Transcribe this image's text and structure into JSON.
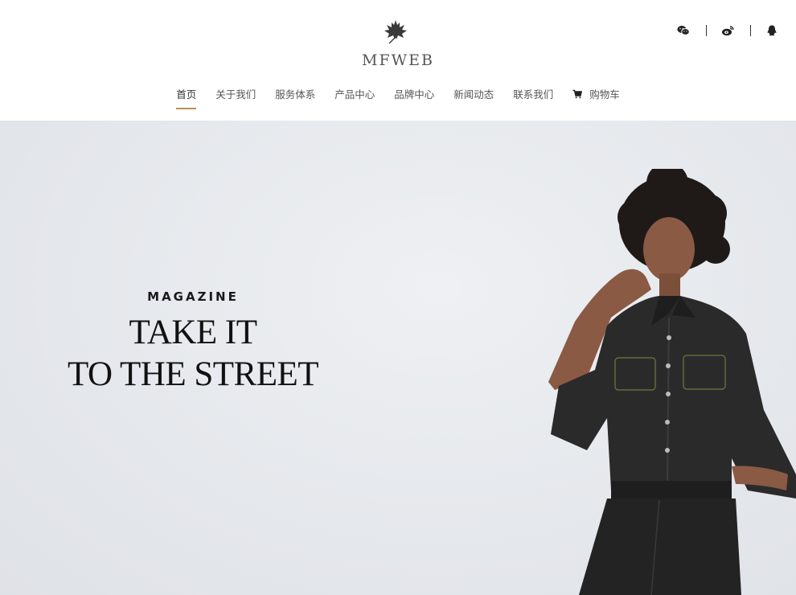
{
  "header": {
    "logo_text": "MFWEB",
    "social": [
      {
        "icon": "wechat-icon"
      },
      {
        "icon": "weibo-icon"
      },
      {
        "icon": "qq-icon"
      }
    ]
  },
  "nav": {
    "items": [
      {
        "label": "首页",
        "active": true
      },
      {
        "label": "关于我们"
      },
      {
        "label": "服务体系"
      },
      {
        "label": "产品中心"
      },
      {
        "label": "品牌中心"
      },
      {
        "label": "新闻动态"
      },
      {
        "label": "联系我们"
      },
      {
        "label": "购物车",
        "icon": "cart-icon"
      }
    ]
  },
  "hero": {
    "kicker": "MAGAZINE",
    "title_line1": "TAKE IT",
    "title_line2": "TO THE STREET"
  },
  "colors": {
    "accent": "#b89352",
    "hero_bg": "#e5e8ec",
    "text_dark": "#111111"
  }
}
